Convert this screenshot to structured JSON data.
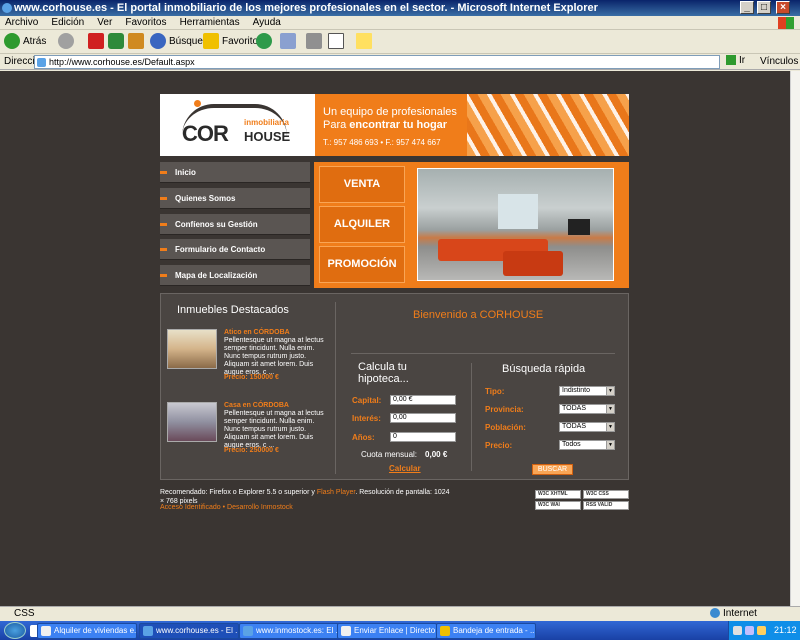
{
  "window": {
    "title": "www.corhouse.es - El portal inmobiliario de los mejores profesionales en el sector. - Microsoft Internet Explorer",
    "minimize": "_",
    "maximize": "□",
    "close": "×"
  },
  "menu": [
    "Archivo",
    "Edición",
    "Ver",
    "Favoritos",
    "Herramientas",
    "Ayuda"
  ],
  "toolbar": {
    "back": "Atrás",
    "search": "Búsqueda",
    "favorites": "Favoritos"
  },
  "address": {
    "label": "Dirección",
    "url": "http://www.corhouse.es/Default.aspx",
    "go": "Ir",
    "links": "Vínculos"
  },
  "site": {
    "logo": {
      "brand_top": "COR",
      "brand_bottom": "HOUSE",
      "sub": "inmobiliaria"
    },
    "slogan_line1": "Un equipo de profesionales",
    "slogan_line2_a": "Para ",
    "slogan_line2_b": "encontrar tu hogar",
    "phones": "T.: 957 486 693 • F.: 957 474 667",
    "nav": [
      "Inicio",
      "Quienes Somos",
      "Confíenos su Gestión",
      "Formulario de Contacto",
      "Mapa de Localización"
    ],
    "hero_buttons": [
      "VENTA",
      "ALQUILER",
      "PROMOCIÓN"
    ],
    "featured_title": "Inmuebles Destacados",
    "properties": [
      {
        "title": "Atico en CÓRDOBA",
        "desc": "Pellentesque ut magna at lectus semper tincidunt. Nulla enim. Nunc tempus rutrum justo. Aliquam sit amet lorem. Duis augue eros, c ...",
        "price": "Precio: 150000 €"
      },
      {
        "title": "Casa en CÓRDOBA",
        "desc": "Pellentesque ut magna at lectus semper tincidunt. Nulla enim. Nunc tempus rutrum justo. Aliquam sit amet lorem. Duis augue eros, c ...",
        "price": "Precio: 250000 €"
      }
    ],
    "welcome": "Bienvenido a CORHOUSE",
    "calc": {
      "title": "Calcula tu hipoteca...",
      "capital_label": "Capital:",
      "capital_value": "0,00 €",
      "interest_label": "Interés:",
      "interest_value": "0,00",
      "years_label": "Años:",
      "years_value": "0",
      "cuota_label": "Cuota mensual:",
      "cuota_value": "0,00 €",
      "calculate": "Calcular"
    },
    "search": {
      "title": "Búsqueda rápida",
      "tipo_label": "Tipo:",
      "tipo_value": "Indistinto",
      "provincia_label": "Provincia:",
      "provincia_value": "TODAS",
      "poblacion_label": "Población:",
      "poblacion_value": "TODAS",
      "precio_label": "Precio:",
      "precio_value": "Todos",
      "button": "BUSCAR"
    },
    "footer": {
      "text_a": "Recomendado: Firefox o Explorer 5.5 o superior y ",
      "text_flash": "Flash Player",
      "text_b": ". Resolución de pantalla: 1024 × 768 pixels",
      "links": "Acceso Identificado • Desarrollo Inmostock"
    },
    "badges": [
      "W3C XHTML",
      "W3C CSS",
      "W3C WAI",
      "RSS VALID"
    ]
  },
  "status": {
    "left": "CSS",
    "zone": "Internet"
  },
  "taskbar": {
    "tasks": [
      "Alquiler de viviendas e...",
      "www.corhouse.es - El ...",
      "www.inmostock.es: El ...",
      "Enviar Enlace | Directo...",
      "Bandeja de entrada - ..."
    ],
    "clock": "21:12"
  }
}
